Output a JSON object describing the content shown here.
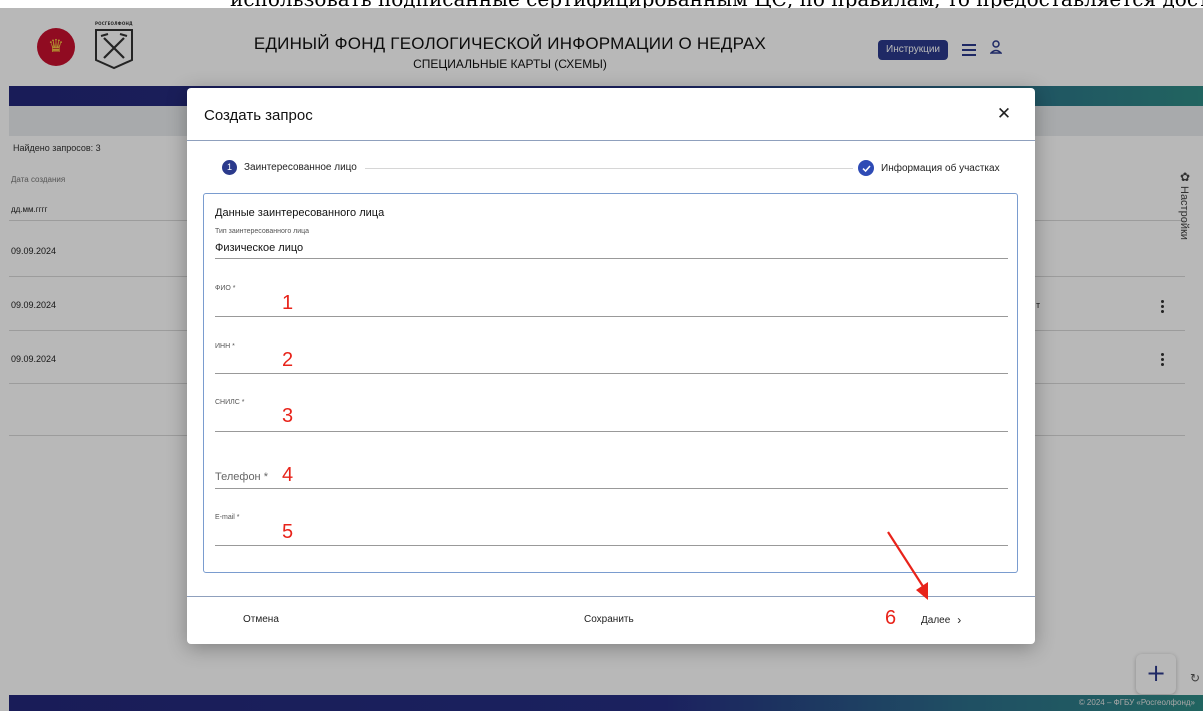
{
  "caption_fragment": "использовать подписанные сертифицированным ЦС, по правилам, то предоставляется доступ",
  "header": {
    "title": "ЕДИНЫЙ ФОНД ГЕОЛОГИЧЕСКОЙ ИНФОРМАЦИИ О НЕДРАХ",
    "subtitle": "СПЕЦИАЛЬНЫЕ КАРТЫ (СХЕМЫ)",
    "instructions_label": "Инструкции",
    "logo_label": "РОСГЕОЛФОНД"
  },
  "list": {
    "found": "Найдено запросов: 3",
    "col_date": "Дата создания",
    "date_filter_placeholder": "дд.мм.гггг",
    "rows": [
      "09.09.2024",
      "09.09.2024",
      "09.09.2024"
    ],
    "row_fragment": "т"
  },
  "settings_label": "Настройки",
  "footer": {
    "copyright": "© 2024 – ФГБУ «Росгеолфонд»"
  },
  "modal": {
    "title": "Создать запрос",
    "steps": [
      {
        "number": "1",
        "label": "Заинтересованное лицо"
      },
      {
        "label": "Информация об участках"
      }
    ],
    "section_title": "Данные заинтересованного лица",
    "type_label": "Тип заинтересованного лица",
    "type_value": "Физическое лицо",
    "fields": [
      {
        "label": "ФИО *",
        "annotation": "1"
      },
      {
        "label": "ИНН *",
        "annotation": "2"
      },
      {
        "label": "СНИЛС *",
        "annotation": "3"
      },
      {
        "label": "Телефон *",
        "annotation": "4"
      },
      {
        "label": "E-mail *",
        "annotation": "5"
      }
    ],
    "footer": {
      "cancel": "Отмена",
      "save": "Сохранить",
      "next": "Далее",
      "next_annotation": "6"
    }
  },
  "colors": {
    "primary": "#2b3a8c",
    "annotation": "#e8231a",
    "band_start": "#23287a",
    "band_end": "#2f8b86"
  }
}
